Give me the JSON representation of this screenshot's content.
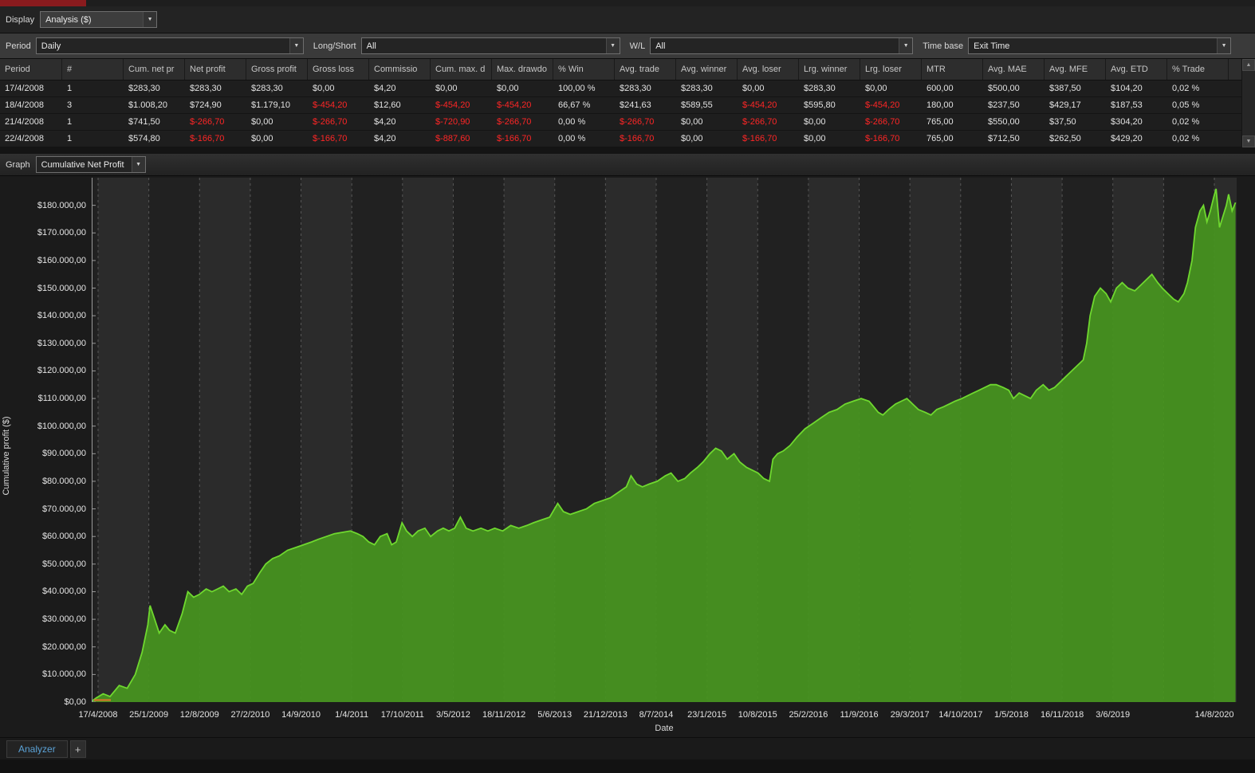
{
  "titlebar": {
    "tab_color": "#8a1b1e"
  },
  "display_row": {
    "label": "Display",
    "value": "Analysis ($)"
  },
  "filters": {
    "period_label": "Period",
    "period_value": "Daily",
    "longshort_label": "Long/Short",
    "longshort_value": "All",
    "wl_label": "W/L",
    "wl_value": "All",
    "timebase_label": "Time base",
    "timebase_value": "Exit Time"
  },
  "table": {
    "columns": [
      "Period",
      "#",
      "Cum. net pr",
      "Net profit",
      "Gross profit",
      "Gross loss",
      "Commissio",
      "Cum. max. d",
      "Max. drawdo",
      "% Win",
      "Avg. trade",
      "Avg. winner",
      "Avg. loser",
      "Lrg. winner",
      "Lrg. loser",
      "MTR",
      "Avg. MAE",
      "Avg. MFE",
      "Avg. ETD",
      "% Trade"
    ],
    "rows": [
      [
        "17/4/2008",
        "1",
        "$283,30",
        "$283,30",
        "$283,30",
        "$0,00",
        "$4,20",
        "$0,00",
        "$0,00",
        "100,00 %",
        "$283,30",
        "$283,30",
        "$0,00",
        "$283,30",
        "$0,00",
        "600,00",
        "$500,00",
        "$387,50",
        "$104,20",
        "0,02 %"
      ],
      [
        "18/4/2008",
        "3",
        "$1.008,20",
        "$724,90",
        "$1.179,10",
        "$-454,20",
        "$12,60",
        "$-454,20",
        "$-454,20",
        "66,67 %",
        "$241,63",
        "$589,55",
        "$-454,20",
        "$595,80",
        "$-454,20",
        "180,00",
        "$237,50",
        "$429,17",
        "$187,53",
        "0,05 %"
      ],
      [
        "21/4/2008",
        "1",
        "$741,50",
        "$-266,70",
        "$0,00",
        "$-266,70",
        "$4,20",
        "$-720,90",
        "$-266,70",
        "0,00 %",
        "$-266,70",
        "$0,00",
        "$-266,70",
        "$0,00",
        "$-266,70",
        "765,00",
        "$550,00",
        "$37,50",
        "$304,20",
        "0,02 %"
      ],
      [
        "22/4/2008",
        "1",
        "$574,80",
        "$-166,70",
        "$0,00",
        "$-166,70",
        "$4,20",
        "$-887,60",
        "$-166,70",
        "0,00 %",
        "$-166,70",
        "$0,00",
        "$-166,70",
        "$0,00",
        "$-166,70",
        "765,00",
        "$712,50",
        "$262,50",
        "$429,20",
        "0,02 %"
      ]
    ]
  },
  "graph_row": {
    "label": "Graph",
    "value": "Cumulative Net Profit"
  },
  "colors": {
    "negative": "#ff2626",
    "line": "#6fd82f",
    "fill": "#47941f",
    "band_light": "#2b2b2b",
    "band_dark": "#212121",
    "gridline": "#575757",
    "axis": "#9a9a9a",
    "marker": "#c87a28",
    "analyzer_tab_text": "#5ba2d6",
    "title_tab_red": "#8a1b1e"
  },
  "chart_data": {
    "type": "area",
    "title": "",
    "xlabel": "Date",
    "ylabel": "Cumulative profit ($)",
    "ylim": [
      0,
      190000
    ],
    "grid": "vertical-dashed",
    "legend": "none",
    "num_gridlines": 23,
    "y_tick_values": [
      0,
      10000,
      20000,
      30000,
      40000,
      50000,
      60000,
      70000,
      80000,
      90000,
      100000,
      110000,
      120000,
      130000,
      140000,
      150000,
      160000,
      170000,
      180000
    ],
    "y_ticks": [
      "$0,00",
      "$10.000,00",
      "$20.000,00",
      "$30.000,00",
      "$40.000,00",
      "$50.000,00",
      "$60.000,00",
      "$70.000,00",
      "$80.000,00",
      "$90.000,00",
      "$100.000,00",
      "$110.000,00",
      "$120.000,00",
      "$130.000,00",
      "$140.000,00",
      "$150.000,00",
      "$160.000,00",
      "$170.000,00",
      "$180.000,00"
    ],
    "x_tick_labels": [
      "17/4/2008",
      "25/1/2009",
      "12/8/2009",
      "27/2/2010",
      "14/9/2010",
      "1/4/2011",
      "17/10/2011",
      "3/5/2012",
      "18/11/2012",
      "5/6/2013",
      "21/12/2013",
      "8/7/2014",
      "23/1/2015",
      "10/8/2015",
      "25/2/2016",
      "11/9/2016",
      "29/3/2017",
      "14/10/2017",
      "1/5/2018",
      "16/11/2018",
      "3/6/2019",
      "14/8/2020"
    ],
    "x_tick_positions": [
      0,
      1,
      2,
      3,
      4,
      5,
      6,
      7,
      8,
      9,
      10,
      11,
      12,
      13,
      14,
      15,
      16,
      17,
      18,
      19,
      20,
      22
    ],
    "series": [
      {
        "name": "Cumulative Net Profit",
        "points": [
          [
            0.0,
            300
          ],
          [
            0.004,
            1500
          ],
          [
            0.01,
            3000
          ],
          [
            0.016,
            2000
          ],
          [
            0.024,
            6000
          ],
          [
            0.031,
            5000
          ],
          [
            0.038,
            10000
          ],
          [
            0.044,
            18000
          ],
          [
            0.049,
            28000
          ],
          [
            0.051,
            35000
          ],
          [
            0.055,
            30000
          ],
          [
            0.059,
            25000
          ],
          [
            0.064,
            28000
          ],
          [
            0.068,
            26000
          ],
          [
            0.073,
            25000
          ],
          [
            0.079,
            32000
          ],
          [
            0.084,
            40000
          ],
          [
            0.089,
            38000
          ],
          [
            0.094,
            39000
          ],
          [
            0.1,
            41000
          ],
          [
            0.105,
            40000
          ],
          [
            0.11,
            41000
          ],
          [
            0.115,
            42000
          ],
          [
            0.12,
            40000
          ],
          [
            0.126,
            41000
          ],
          [
            0.131,
            39000
          ],
          [
            0.136,
            42000
          ],
          [
            0.141,
            43000
          ],
          [
            0.147,
            47000
          ],
          [
            0.152,
            50000
          ],
          [
            0.158,
            52000
          ],
          [
            0.164,
            53000
          ],
          [
            0.171,
            55000
          ],
          [
            0.178,
            56000
          ],
          [
            0.185,
            57000
          ],
          [
            0.192,
            58000
          ],
          [
            0.198,
            59000
          ],
          [
            0.205,
            60000
          ],
          [
            0.212,
            61000
          ],
          [
            0.219,
            61500
          ],
          [
            0.226,
            62000
          ],
          [
            0.232,
            61000
          ],
          [
            0.237,
            60000
          ],
          [
            0.242,
            58000
          ],
          [
            0.247,
            57000
          ],
          [
            0.252,
            60000
          ],
          [
            0.258,
            61000
          ],
          [
            0.262,
            57000
          ],
          [
            0.266,
            58000
          ],
          [
            0.271,
            65000
          ],
          [
            0.275,
            62000
          ],
          [
            0.28,
            60000
          ],
          [
            0.285,
            62000
          ],
          [
            0.291,
            63000
          ],
          [
            0.296,
            60000
          ],
          [
            0.302,
            62000
          ],
          [
            0.307,
            63000
          ],
          [
            0.312,
            62000
          ],
          [
            0.317,
            63000
          ],
          [
            0.322,
            67000
          ],
          [
            0.327,
            63000
          ],
          [
            0.333,
            62000
          ],
          [
            0.34,
            63000
          ],
          [
            0.346,
            62000
          ],
          [
            0.352,
            63000
          ],
          [
            0.359,
            62000
          ],
          [
            0.366,
            64000
          ],
          [
            0.373,
            63000
          ],
          [
            0.38,
            64000
          ],
          [
            0.386,
            65000
          ],
          [
            0.393,
            66000
          ],
          [
            0.4,
            67000
          ],
          [
            0.407,
            72000
          ],
          [
            0.412,
            69000
          ],
          [
            0.418,
            68000
          ],
          [
            0.425,
            69000
          ],
          [
            0.432,
            70000
          ],
          [
            0.439,
            72000
          ],
          [
            0.446,
            73000
          ],
          [
            0.453,
            74000
          ],
          [
            0.46,
            76000
          ],
          [
            0.467,
            78000
          ],
          [
            0.471,
            82000
          ],
          [
            0.476,
            79000
          ],
          [
            0.481,
            78000
          ],
          [
            0.487,
            79000
          ],
          [
            0.494,
            80000
          ],
          [
            0.501,
            82000
          ],
          [
            0.506,
            83000
          ],
          [
            0.512,
            80000
          ],
          [
            0.518,
            81000
          ],
          [
            0.523,
            83000
          ],
          [
            0.529,
            85000
          ],
          [
            0.534,
            87000
          ],
          [
            0.54,
            90000
          ],
          [
            0.545,
            92000
          ],
          [
            0.55,
            91000
          ],
          [
            0.555,
            88000
          ],
          [
            0.561,
            90000
          ],
          [
            0.566,
            87000
          ],
          [
            0.572,
            85000
          ],
          [
            0.577,
            84000
          ],
          [
            0.582,
            83000
          ],
          [
            0.587,
            81000
          ],
          [
            0.592,
            80000
          ],
          [
            0.595,
            88000
          ],
          [
            0.599,
            90000
          ],
          [
            0.604,
            91000
          ],
          [
            0.61,
            93000
          ],
          [
            0.616,
            96000
          ],
          [
            0.623,
            99000
          ],
          [
            0.63,
            101000
          ],
          [
            0.637,
            103000
          ],
          [
            0.644,
            105000
          ],
          [
            0.651,
            106000
          ],
          [
            0.658,
            108000
          ],
          [
            0.665,
            109000
          ],
          [
            0.672,
            110000
          ],
          [
            0.679,
            109000
          ],
          [
            0.683,
            107000
          ],
          [
            0.687,
            105000
          ],
          [
            0.691,
            104000
          ],
          [
            0.696,
            106000
          ],
          [
            0.702,
            108000
          ],
          [
            0.707,
            109000
          ],
          [
            0.712,
            110000
          ],
          [
            0.717,
            108000
          ],
          [
            0.722,
            106000
          ],
          [
            0.728,
            105000
          ],
          [
            0.733,
            104000
          ],
          [
            0.738,
            106000
          ],
          [
            0.744,
            107000
          ],
          [
            0.749,
            108000
          ],
          [
            0.754,
            109000
          ],
          [
            0.76,
            110000
          ],
          [
            0.765,
            111000
          ],
          [
            0.77,
            112000
          ],
          [
            0.775,
            113000
          ],
          [
            0.78,
            114000
          ],
          [
            0.785,
            115000
          ],
          [
            0.79,
            115000
          ],
          [
            0.796,
            114000
          ],
          [
            0.801,
            113000
          ],
          [
            0.805,
            110000
          ],
          [
            0.81,
            112000
          ],
          [
            0.815,
            111000
          ],
          [
            0.82,
            110000
          ],
          [
            0.825,
            113000
          ],
          [
            0.831,
            115000
          ],
          [
            0.836,
            113000
          ],
          [
            0.841,
            114000
          ],
          [
            0.846,
            116000
          ],
          [
            0.851,
            118000
          ],
          [
            0.856,
            120000
          ],
          [
            0.861,
            122000
          ],
          [
            0.866,
            124000
          ],
          [
            0.869,
            130000
          ],
          [
            0.872,
            140000
          ],
          [
            0.876,
            147000
          ],
          [
            0.881,
            150000
          ],
          [
            0.886,
            148000
          ],
          [
            0.89,
            145000
          ],
          [
            0.895,
            150000
          ],
          [
            0.9,
            152000
          ],
          [
            0.905,
            150000
          ],
          [
            0.911,
            149000
          ],
          [
            0.916,
            151000
          ],
          [
            0.921,
            153000
          ],
          [
            0.926,
            155000
          ],
          [
            0.931,
            152000
          ],
          [
            0.935,
            150000
          ],
          [
            0.94,
            148000
          ],
          [
            0.945,
            146000
          ],
          [
            0.949,
            145000
          ],
          [
            0.954,
            148000
          ],
          [
            0.957,
            152000
          ],
          [
            0.961,
            160000
          ],
          [
            0.964,
            172000
          ],
          [
            0.968,
            178000
          ],
          [
            0.971,
            180000
          ],
          [
            0.974,
            174000
          ],
          [
            0.977,
            178000
          ],
          [
            0.98,
            183000
          ],
          [
            0.982,
            186000
          ],
          [
            0.985,
            172000
          ],
          [
            0.988,
            176000
          ],
          [
            0.991,
            180000
          ],
          [
            0.993,
            184000
          ],
          [
            0.996,
            178000
          ],
          [
            0.999,
            181000
          ]
        ]
      }
    ]
  },
  "footer": {
    "tab_label": "Analyzer",
    "add_tab_label": "+"
  }
}
